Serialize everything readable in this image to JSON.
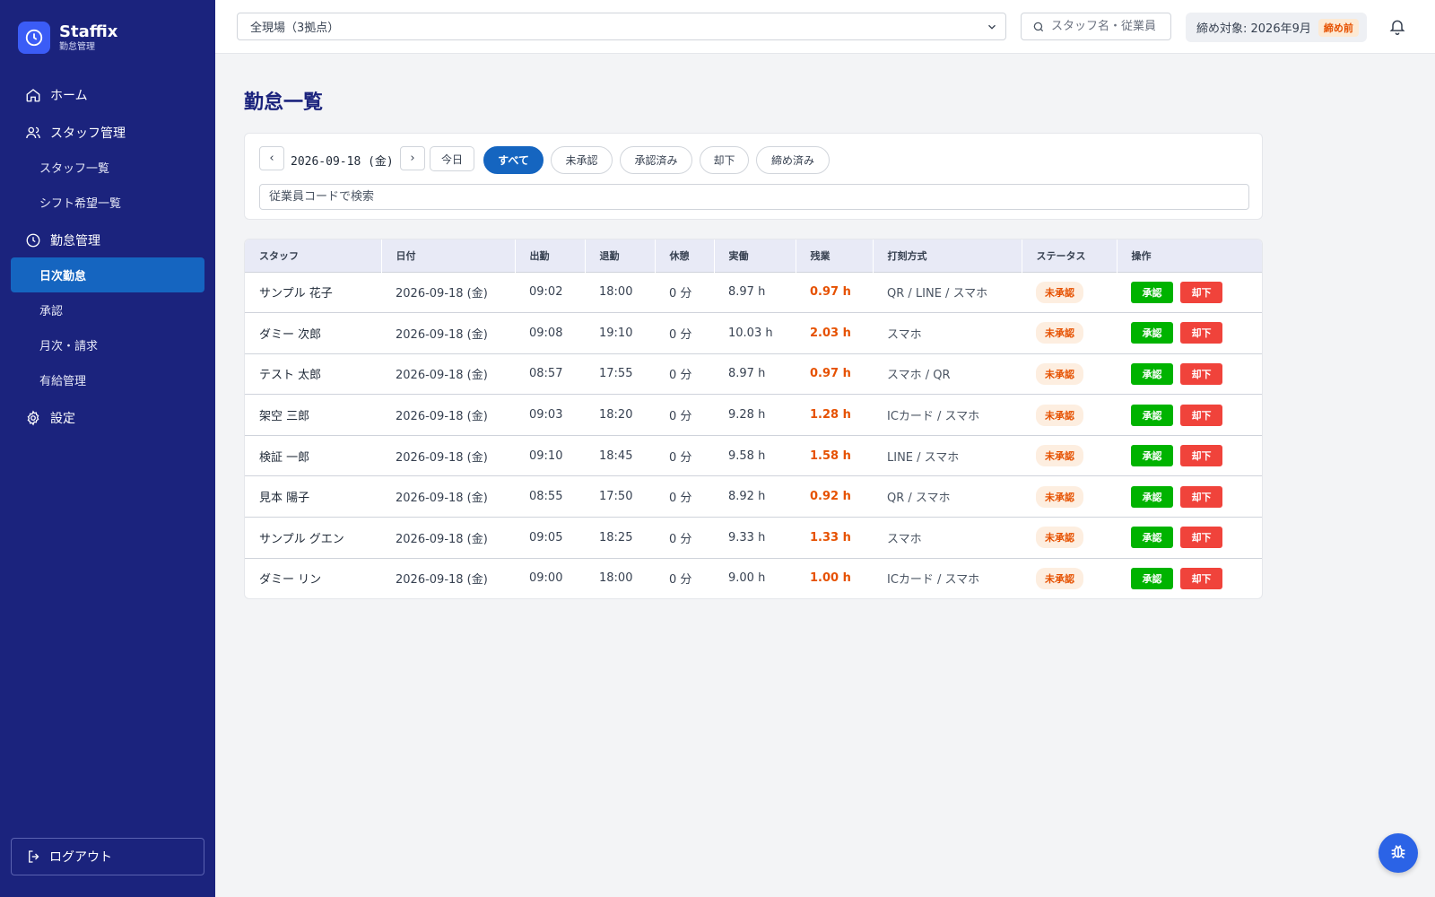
{
  "brand": {
    "name": "Staffix",
    "subtitle": "勤怠管理"
  },
  "sidebar": {
    "items": [
      {
        "label": "ホーム",
        "icon": "home-icon"
      },
      {
        "label": "スタッフ管理",
        "icon": "users-icon"
      },
      {
        "label": "スタッフ一覧"
      },
      {
        "label": "シフト希望一覧"
      },
      {
        "label": "勤怠管理",
        "icon": "clock-icon"
      },
      {
        "label": "日次勤怠",
        "active": true
      },
      {
        "label": "承認"
      },
      {
        "label": "月次・請求"
      },
      {
        "label": "有給管理"
      },
      {
        "label": "設定",
        "icon": "gear-icon"
      }
    ],
    "logout": "ログアウト"
  },
  "topbar": {
    "site_select": "全現場（3拠点）",
    "search_placeholder": "スタッフ名・従業員コード",
    "closing_label": "締め対象: 2026年9月",
    "closing_badge": "締め前"
  },
  "page": {
    "title": "勤怠一覧"
  },
  "filters": {
    "prev": "‹",
    "next": "›",
    "date": "2026-09-18 (金)",
    "today": "今日",
    "tabs": [
      "すべて",
      "未承認",
      "承認済み",
      "却下",
      "締め済み"
    ],
    "active_tab": "すべて",
    "code_search_placeholder": "従業員コードで検索"
  },
  "table": {
    "headers": [
      "スタッフ",
      "日付",
      "出勤",
      "退勤",
      "休憩",
      "実働",
      "残業",
      "打刻方式",
      "ステータス",
      "操作"
    ],
    "approve_label": "承認",
    "reject_label": "却下",
    "rows": [
      {
        "staff": "サンプル 花子",
        "date": "2026-09-18 (金)",
        "in": "09:02",
        "out": "18:00",
        "break": "0 分",
        "work": "8.97 h",
        "overtime": "0.97 h",
        "method": "QR / LINE / スマホ",
        "status": "未承認"
      },
      {
        "staff": "ダミー 次郎",
        "date": "2026-09-18 (金)",
        "in": "09:08",
        "out": "19:10",
        "break": "0 分",
        "work": "10.03 h",
        "overtime": "2.03 h",
        "method": "スマホ",
        "status": "未承認"
      },
      {
        "staff": "テスト 太郎",
        "date": "2026-09-18 (金)",
        "in": "08:57",
        "out": "17:55",
        "break": "0 分",
        "work": "8.97 h",
        "overtime": "0.97 h",
        "method": "スマホ / QR",
        "status": "未承認"
      },
      {
        "staff": "架空 三郎",
        "date": "2026-09-18 (金)",
        "in": "09:03",
        "out": "18:20",
        "break": "0 分",
        "work": "9.28 h",
        "overtime": "1.28 h",
        "method": "ICカード / スマホ",
        "status": "未承認"
      },
      {
        "staff": "検証 一郎",
        "date": "2026-09-18 (金)",
        "in": "09:10",
        "out": "18:45",
        "break": "0 分",
        "work": "9.58 h",
        "overtime": "1.58 h",
        "method": "LINE / スマホ",
        "status": "未承認"
      },
      {
        "staff": "見本 陽子",
        "date": "2026-09-18 (金)",
        "in": "08:55",
        "out": "17:50",
        "break": "0 分",
        "work": "8.92 h",
        "overtime": "0.92 h",
        "method": "QR / スマホ",
        "status": "未承認"
      },
      {
        "staff": "サンプル グエン",
        "date": "2026-09-18 (金)",
        "in": "09:05",
        "out": "18:25",
        "break": "0 分",
        "work": "9.33 h",
        "overtime": "1.33 h",
        "method": "スマホ",
        "status": "未承認"
      },
      {
        "staff": "ダミー リン",
        "date": "2026-09-18 (金)",
        "in": "09:00",
        "out": "18:00",
        "break": "0 分",
        "work": "9.00 h",
        "overtime": "1.00 h",
        "method": "ICカード / スマホ",
        "status": "未承認"
      }
    ]
  },
  "colors": {
    "sidebar_bg": "#1b237d",
    "accent": "#1565c0",
    "approve": "#00b300",
    "reject": "#f0433b",
    "overtime": "#e65100"
  }
}
